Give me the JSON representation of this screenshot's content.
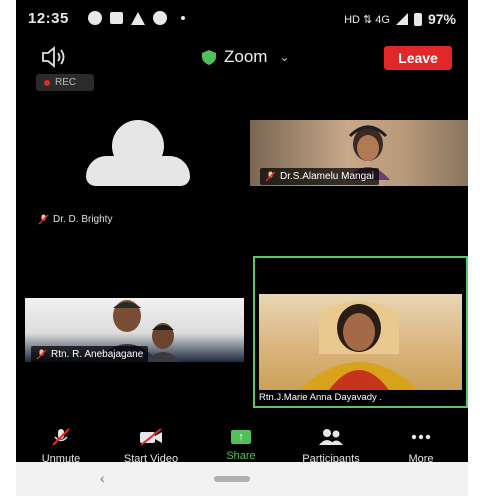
{
  "status_bar": {
    "time": "12:35",
    "network": "HD ⇅ 4G",
    "battery": "97%"
  },
  "top_bar": {
    "meeting_title": "Zoom",
    "leave_label": "Leave",
    "rec_label": "REC"
  },
  "participants": {
    "avatar_name": "Dr. D. Brighty",
    "tile1_name": "Dr.S.Alamelu Mangai",
    "tile2_name": "Rtn. R. Anebajagane",
    "tile3_name": "Rtn.J.Marie Anna Dayavady ."
  },
  "toolbar": {
    "unmute": "Unmute",
    "start_video": "Start Video",
    "share": "Share",
    "participants": "Participants",
    "more": "More"
  },
  "colors": {
    "leave": "#e02828",
    "active_speaker": "#5cc86a",
    "share": "#4fc05b"
  }
}
